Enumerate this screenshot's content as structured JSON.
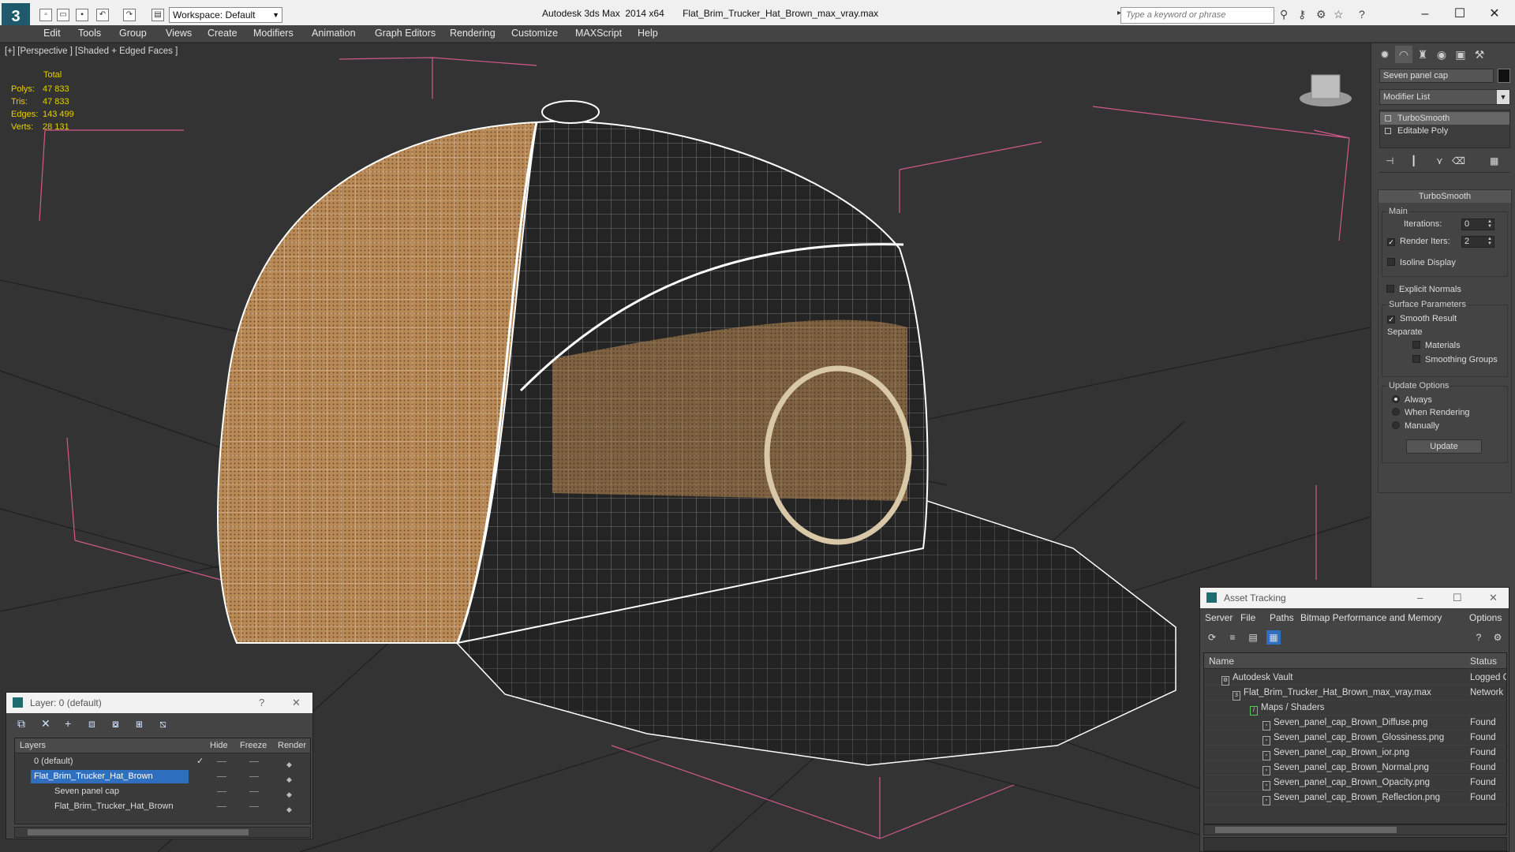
{
  "app": {
    "logo_letter": "3",
    "window_title": "Autodesk 3ds Max  2014 x64       Flat_Brim_Trucker_Hat_Brown_max_vray.max",
    "workspace": "Workspace: Default",
    "search_placeholder": "Type a keyword or phrase"
  },
  "menu": [
    "Edit",
    "Tools",
    "Group",
    "Views",
    "Create",
    "Modifiers",
    "Animation",
    "Graph Editors",
    "Rendering",
    "Customize",
    "MAXScript",
    "Help"
  ],
  "viewport": {
    "label": "[+] [Perspective ] [Shaded + Edged Faces ]",
    "stats": {
      "total_label": "Total",
      "rows": [
        {
          "label": "Polys:",
          "value": "47 833"
        },
        {
          "label": "Tris:",
          "value": "47 833"
        },
        {
          "label": "Edges:",
          "value": "143 499"
        },
        {
          "label": "Verts:",
          "value": "28 131"
        }
      ]
    },
    "colors": {
      "background": "#333333",
      "grid": "#1f1f1f",
      "bbox": "#d05a8a",
      "wire": "#ffffff",
      "fabric": "#b98a55",
      "dark": "#222222"
    }
  },
  "command_panel": {
    "object_name": "Seven panel cap",
    "modifier_list": "Modifier List",
    "stack": [
      "TurboSmooth",
      "Editable Poly"
    ],
    "rollout_title": "TurboSmooth",
    "main_group": "Main",
    "iterations_label": "Iterations:",
    "iterations_value": "0",
    "render_iters_label": "Render Iters:",
    "render_iters_value": "2",
    "isoline": "Isoline Display",
    "explicit": "Explicit Normals",
    "surface_group": "Surface Parameters",
    "smooth_result": "Smooth Result",
    "separate_label": "Separate",
    "materials": "Materials",
    "smoothing_groups": "Smoothing Groups",
    "update_group": "Update Options",
    "always": "Always",
    "when_rendering": "When Rendering",
    "manually": "Manually",
    "update_btn": "Update"
  },
  "layer_dialog": {
    "title": "Layer: 0 (default)",
    "help": "?",
    "close": "✕",
    "columns": {
      "layers": "Layers",
      "hide": "Hide",
      "freeze": "Freeze",
      "render": "Render"
    },
    "rows": [
      {
        "name": "0 (default)"
      },
      {
        "name": "Flat_Brim_Trucker_Hat_Brown"
      },
      {
        "name": "Seven panel cap"
      },
      {
        "name": "Flat_Brim_Trucker_Hat_Brown"
      }
    ]
  },
  "asset_tracking": {
    "title": "Asset Tracking",
    "menu": [
      "Server",
      "File",
      "Paths",
      "Bitmap Performance and Memory",
      "Options"
    ],
    "columns": {
      "name": "Name",
      "status": "Status"
    },
    "rows": [
      {
        "name": "Autodesk Vault",
        "status": "Logged C"
      },
      {
        "name": "Flat_Brim_Trucker_Hat_Brown_max_vray.max",
        "status": "Network"
      },
      {
        "name": "Maps / Shaders",
        "status": ""
      },
      {
        "name": "Seven_panel_cap_Brown_Diffuse.png",
        "status": "Found"
      },
      {
        "name": "Seven_panel_cap_Brown_Glossiness.png",
        "status": "Found"
      },
      {
        "name": "Seven_panel_cap_Brown_ior.png",
        "status": "Found"
      },
      {
        "name": "Seven_panel_cap_Brown_Normal.png",
        "status": "Found"
      },
      {
        "name": "Seven_panel_cap_Brown_Opacity.png",
        "status": "Found"
      },
      {
        "name": "Seven_panel_cap_Brown_Reflection.png",
        "status": "Found"
      }
    ]
  }
}
